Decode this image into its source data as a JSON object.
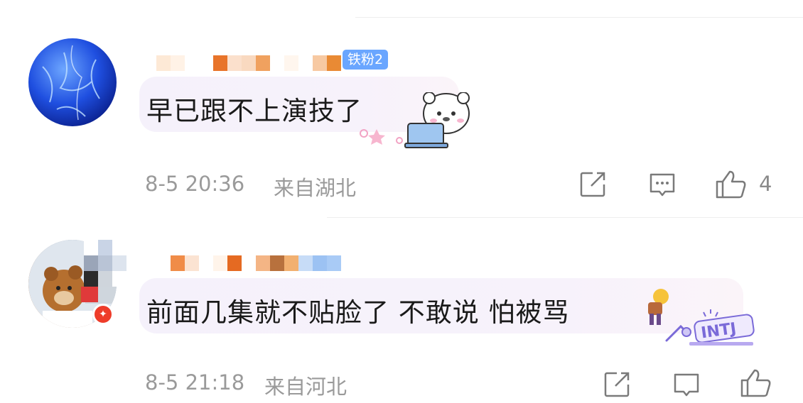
{
  "comments": [
    {
      "badge": "铁粉2",
      "text": "早已跟不上演技了",
      "time": "8-5 20:36",
      "location": "来自湖北",
      "likes": "4",
      "sticker": "bear-laptop-sticker"
    },
    {
      "text": "前面几集就不贴脸了 不敢说 怕被骂",
      "sticker": "intj-sticker",
      "sticker_text": "INTJ",
      "time": "8-5 21:18",
      "location": "来自河北",
      "verified": true
    }
  ],
  "icons": {
    "share": "share-icon",
    "reply": "comment-icon",
    "like": "thumbs-up-icon"
  },
  "colors": {
    "badge": "#6aa6ff",
    "meta_text": "#9a9a9a",
    "bubble": "#f5f1fb",
    "verified": "#ee3c2a"
  }
}
